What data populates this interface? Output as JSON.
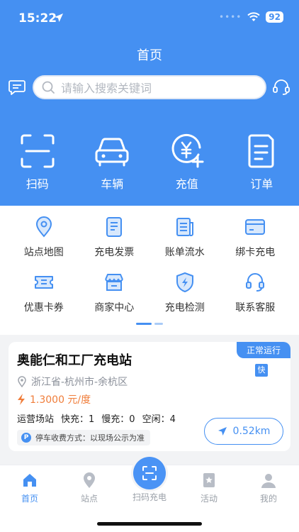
{
  "status_bar": {
    "time": "15:22",
    "battery": "92"
  },
  "header": {
    "title": "首页"
  },
  "search": {
    "placeholder": "请输入搜索关键词"
  },
  "quick_actions": [
    {
      "label": "扫码",
      "icon": "scan-frame-icon"
    },
    {
      "label": "车辆",
      "icon": "car-icon"
    },
    {
      "label": "充值",
      "icon": "yuan-recharge-icon"
    },
    {
      "label": "订单",
      "icon": "order-document-icon"
    }
  ],
  "services": [
    {
      "label": "站点地图",
      "icon": "map-pin-icon"
    },
    {
      "label": "充电发票",
      "icon": "invoice-icon"
    },
    {
      "label": "账单流水",
      "icon": "bill-icon"
    },
    {
      "label": "绑卡充电",
      "icon": "card-icon"
    },
    {
      "label": "优惠卡券",
      "icon": "coupon-icon"
    },
    {
      "label": "商家中心",
      "icon": "shop-icon"
    },
    {
      "label": "充电检测",
      "icon": "shield-bolt-icon"
    },
    {
      "label": "联系客服",
      "icon": "headset-icon"
    }
  ],
  "station": {
    "name": "奥能仁和工厂充电站",
    "status": "正常运行",
    "badge": "快",
    "location": "浙江省-杭州市-余杭区",
    "price": "1.3000 元/度",
    "type": "运营场站",
    "fast": "快充：1",
    "slow": "慢充：0",
    "idle": "空闲：4",
    "parking": "停车收费方式：以现场公示为准",
    "distance": "0.52km"
  },
  "tabs": [
    {
      "label": "首页"
    },
    {
      "label": "站点"
    },
    {
      "label": "扫码充电"
    },
    {
      "label": "活动"
    },
    {
      "label": "我的"
    }
  ],
  "colors": {
    "primary": "#4590f2",
    "price": "#f07d3a",
    "background": "#f2f3f5"
  }
}
